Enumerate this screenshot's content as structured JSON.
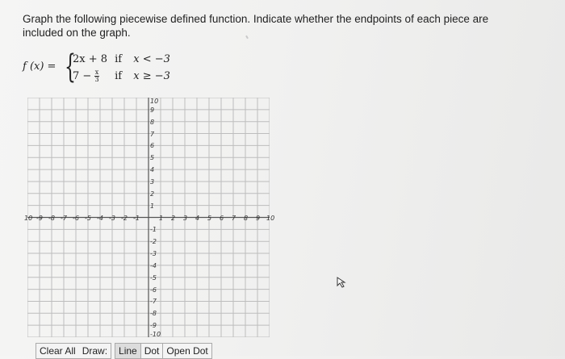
{
  "question": {
    "text": "Graph the following piecewise defined function. Indicate whether the endpoints of each piece are included on the graph."
  },
  "function": {
    "lhs": "f (x) =",
    "piece1_expr": "2x + 8",
    "piece1_if": "if",
    "piece1_cond": "x < −3",
    "piece2_expr_lead": "7 −",
    "piece2_frac_num": "x",
    "piece2_frac_den": "3",
    "piece2_if": "if",
    "piece2_cond": "x ≥ −3"
  },
  "graph": {
    "x_ticks": [
      "10",
      "-9",
      "-8",
      "-7",
      "-6",
      "-5",
      "-4",
      "-3",
      "-2",
      "-1",
      "1",
      "2",
      "3",
      "4",
      "5",
      "6",
      "7",
      "8",
      "9",
      "10"
    ],
    "y_ticks_pos": [
      "10",
      "9",
      "8",
      "7",
      "6",
      "5",
      "4",
      "3",
      "2",
      "1"
    ],
    "y_ticks_neg": [
      "-1",
      "-2",
      "-3",
      "-4",
      "-5",
      "-6",
      "-7",
      "-8",
      "-9",
      "-10"
    ],
    "grid_color": "#bdbdbd",
    "axis_color": "#555555"
  },
  "toolbar": {
    "clear_all": "Clear All",
    "draw": "Draw:",
    "line": "Line",
    "dot": "Dot",
    "open_dot": "Open Dot"
  }
}
